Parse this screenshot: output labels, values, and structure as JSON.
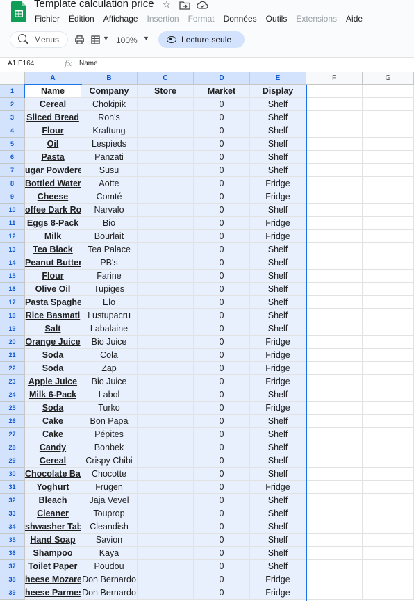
{
  "app": {
    "title": "Template calculation price",
    "menu": [
      "Fichier",
      "Édition",
      "Affichage",
      "Insertion",
      "Format",
      "Données",
      "Outils",
      "Extensions",
      "Aide"
    ],
    "menu_disabled": [
      false,
      false,
      false,
      true,
      true,
      false,
      false,
      true,
      false
    ]
  },
  "toolbar": {
    "search_label": "Menus",
    "zoom": "100%",
    "readonly_label": "Lecture seule"
  },
  "formula_bar": {
    "name_box": "A1:E164",
    "fx": "fx",
    "value": "Name"
  },
  "grid": {
    "columns": [
      "A",
      "B",
      "C",
      "D",
      "E",
      "F",
      "G"
    ],
    "selected_columns": [
      "A",
      "B",
      "C",
      "D",
      "E"
    ],
    "header_row": [
      "Name",
      "Company",
      "Store",
      "Market",
      "Display"
    ],
    "rows": [
      {
        "n": "2",
        "name": "Cereal",
        "company": "Chokipik",
        "store": "",
        "market": "0",
        "display": "Shelf"
      },
      {
        "n": "3",
        "name": "Sliced Bread",
        "company": "Ron's",
        "store": "",
        "market": "0",
        "display": "Shelf"
      },
      {
        "n": "4",
        "name": "Flour",
        "company": "Kraftung",
        "store": "",
        "market": "0",
        "display": "Shelf"
      },
      {
        "n": "5",
        "name": "Oil",
        "company": "Lespieds",
        "store": "",
        "market": "0",
        "display": "Shelf"
      },
      {
        "n": "6",
        "name": "Pasta",
        "company": "Panzati",
        "store": "",
        "market": "0",
        "display": "Shelf"
      },
      {
        "n": "7",
        "name": "ugar Powdere",
        "company": "Susu",
        "store": "",
        "market": "0",
        "display": "Shelf"
      },
      {
        "n": "8",
        "name": "Bottled Water",
        "company": "Aotte",
        "store": "",
        "market": "0",
        "display": "Fridge"
      },
      {
        "n": "9",
        "name": "Cheese",
        "company": "Comté",
        "store": "",
        "market": "0",
        "display": "Fridge"
      },
      {
        "n": "10",
        "name": "offee Dark Roa",
        "company": "Narvalo",
        "store": "",
        "market": "0",
        "display": "Shelf"
      },
      {
        "n": "11",
        "name": "Eggs 8-Pack",
        "company": "Bio",
        "store": "",
        "market": "0",
        "display": "Fridge"
      },
      {
        "n": "12",
        "name": "Milk",
        "company": "Bourlait",
        "store": "",
        "market": "0",
        "display": "Fridge"
      },
      {
        "n": "13",
        "name": "Tea Black",
        "company": "Tea Palace",
        "store": "",
        "market": "0",
        "display": "Shelf"
      },
      {
        "n": "14",
        "name": "Peanut Butter",
        "company": "PB's",
        "store": "",
        "market": "0",
        "display": "Shelf"
      },
      {
        "n": "15",
        "name": "Flour",
        "company": "Farine",
        "store": "",
        "market": "0",
        "display": "Shelf"
      },
      {
        "n": "16",
        "name": "Olive Oil",
        "company": "Tupiges",
        "store": "",
        "market": "0",
        "display": "Shelf"
      },
      {
        "n": "17",
        "name": "Pasta Spaghett",
        "company": "Elo",
        "store": "",
        "market": "0",
        "display": "Shelf"
      },
      {
        "n": "18",
        "name": "Rice Basmati",
        "company": "Lustupacru",
        "store": "",
        "market": "0",
        "display": "Shelf"
      },
      {
        "n": "19",
        "name": "Salt",
        "company": "Labalaine",
        "store": "",
        "market": "0",
        "display": "Shelf"
      },
      {
        "n": "20",
        "name": "Orange Juice",
        "company": "Bio Juice",
        "store": "",
        "market": "0",
        "display": "Fridge"
      },
      {
        "n": "21",
        "name": "Soda",
        "company": "Cola",
        "store": "",
        "market": "0",
        "display": "Fridge"
      },
      {
        "n": "22",
        "name": "Soda",
        "company": "Zap",
        "store": "",
        "market": "0",
        "display": "Fridge"
      },
      {
        "n": "23",
        "name": "Apple Juice",
        "company": "Bio Juice",
        "store": "",
        "market": "0",
        "display": "Fridge"
      },
      {
        "n": "24",
        "name": "Milk 6-Pack",
        "company": "Labol",
        "store": "",
        "market": "0",
        "display": "Shelf"
      },
      {
        "n": "25",
        "name": "Soda",
        "company": "Turko",
        "store": "",
        "market": "0",
        "display": "Fridge"
      },
      {
        "n": "26",
        "name": "Cake",
        "company": "Bon Papa",
        "store": "",
        "market": "0",
        "display": "Shelf"
      },
      {
        "n": "27",
        "name": "Cake",
        "company": "Pépites",
        "store": "",
        "market": "0",
        "display": "Shelf"
      },
      {
        "n": "28",
        "name": "Candy",
        "company": "Bonbek",
        "store": "",
        "market": "0",
        "display": "Shelf"
      },
      {
        "n": "29",
        "name": "Cereal",
        "company": "Crispy Chibi",
        "store": "",
        "market": "0",
        "display": "Shelf"
      },
      {
        "n": "30",
        "name": "Chocolate Bar",
        "company": "Chocotte",
        "store": "",
        "market": "0",
        "display": "Shelf"
      },
      {
        "n": "31",
        "name": "Yoghurt",
        "company": "Frügen",
        "store": "",
        "market": "0",
        "display": "Fridge"
      },
      {
        "n": "32",
        "name": "Bleach",
        "company": "Jaja Vevel",
        "store": "",
        "market": "0",
        "display": "Shelf"
      },
      {
        "n": "33",
        "name": "Cleaner",
        "company": "Touprop",
        "store": "",
        "market": "0",
        "display": "Shelf"
      },
      {
        "n": "34",
        "name": "shwasher Tabl",
        "company": "Cleandish",
        "store": "",
        "market": "0",
        "display": "Shelf"
      },
      {
        "n": "35",
        "name": "Hand Soap",
        "company": "Savion",
        "store": "",
        "market": "0",
        "display": "Shelf"
      },
      {
        "n": "36",
        "name": "Shampoo",
        "company": "Kaya",
        "store": "",
        "market": "0",
        "display": "Shelf"
      },
      {
        "n": "37",
        "name": "Toilet Paper",
        "company": "Poudou",
        "store": "",
        "market": "0",
        "display": "Shelf"
      },
      {
        "n": "38",
        "name": "heese Mozare",
        "company": "Don Bernardo",
        "store": "",
        "market": "0",
        "display": "Fridge"
      },
      {
        "n": "39",
        "name": "heese Parmes",
        "company": "Don Bernardo",
        "store": "",
        "market": "0",
        "display": "Fridge"
      }
    ]
  },
  "icons": {
    "logo": "sheets-logo-icon",
    "star": "star-icon",
    "move": "move-to-folder-icon",
    "cloud": "cloud-status-icon",
    "search": "search-icon",
    "print": "print-icon",
    "format": "paint-format-icon",
    "readonly": "eye-icon"
  },
  "colors": {
    "selection_header": "#d3e3fd",
    "selection_fill": "#e8f0fe",
    "accent": "#0b57d0",
    "sheets_green": "#0f9d58"
  }
}
